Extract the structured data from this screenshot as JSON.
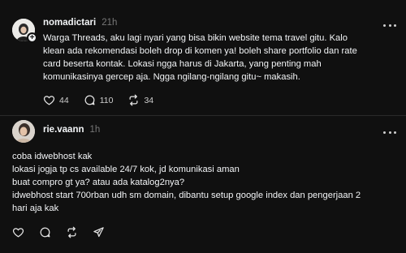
{
  "posts": [
    {
      "username": "nomadictari",
      "time": "21h",
      "lines": [
        "Warga Threads, aku lagi nyari yang bisa bikin website tema travel gitu. Kalo",
        "klean ada rekomendasi boleh drop di komen ya! boleh share portfolio dan rate",
        "card beserta kontak. Lokasi ngga harus di Jakarta, yang penting mah",
        "komunikasinya gercep aja. Ngga ngilang-ngilang gitu~ makasih."
      ],
      "likes": "44",
      "replies": "110",
      "reposts": "34"
    },
    {
      "username": "rie.vaann",
      "time": "1h",
      "lines": [
        "coba idwebhost kak",
        "lokasi jogja tp cs available 24/7 kok, jd komunikasi aman",
        "buat compro gt ya? atau ada katalog2nya?",
        "idwebhost start 700rban udh sm domain, dibantu setup google index dan pengerjaan 2",
        "hari aja kak"
      ]
    }
  ],
  "icons": {
    "like": "heart-icon",
    "reply": "comment-icon",
    "repost": "repost-icon",
    "share": "send-icon",
    "more": "more-icon",
    "follow": "plus-icon"
  },
  "colors": {
    "background": "#101010",
    "text": "#f3f5f7",
    "muted": "#777777",
    "divider": "#2a2a2a"
  }
}
